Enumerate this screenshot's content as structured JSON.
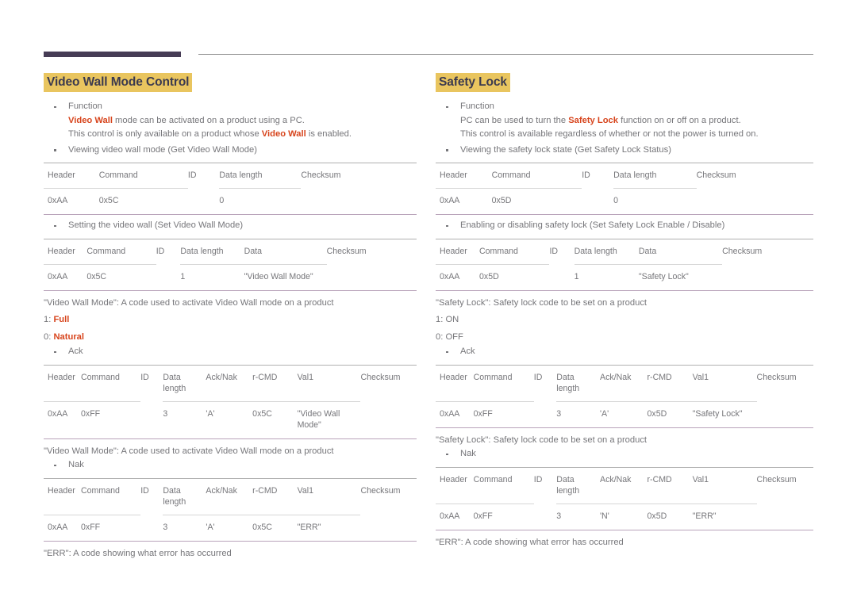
{
  "header": {
    "rule_accent_color": "#463c55",
    "rule_line_color": "#8c8c8c"
  },
  "theme": {
    "heading_highlight": "#e9c55f",
    "heading_text": "#3b3a4f",
    "emphasis": "#d7441c",
    "body_text": "#76767a",
    "table_rule": "#b0b0b0",
    "table_bottom_rule": "#b9a3ba"
  },
  "left": {
    "heading": "Video Wall Mode Control",
    "function_bullet": {
      "label": "Function",
      "line1_pre": "",
      "line1_emph": "Video Wall",
      "line1_post": " mode can be activated on a product using a PC.",
      "line2_pre": "This control is only available on a product whose ",
      "line2_emph": "Video Wall",
      "line2_post": " is enabled."
    },
    "get_bullet": "Viewing video wall mode (Get Video Wall Mode)",
    "get_table": {
      "headers": [
        "Header",
        "Command",
        "ID",
        "Data length",
        "Checksum"
      ],
      "row": [
        "0xAA",
        "0x5C",
        "",
        "0",
        ""
      ]
    },
    "set_bullet": "Setting the video wall (Set Video Wall Mode)",
    "set_table": {
      "headers": [
        "Header",
        "Command",
        "ID",
        "Data length",
        "Data",
        "Checksum"
      ],
      "row": [
        "0xAA",
        "0x5C",
        "",
        "1",
        "\"Video Wall Mode\"",
        ""
      ]
    },
    "note_after_set": "\"Video Wall Mode\": A code used to activate Video Wall mode on a product",
    "values": [
      {
        "key": "1: ",
        "val": "Full"
      },
      {
        "key": "0: ",
        "val": "Natural"
      }
    ],
    "ack_bullet": "Ack",
    "ack_table": {
      "headers": [
        "Header",
        "Command",
        "ID",
        "Data length",
        "Ack/Nak",
        "r-CMD",
        "Val1",
        "Checksum"
      ],
      "row": [
        "0xAA",
        "0xFF",
        "",
        "3",
        "'A'",
        "0x5C",
        "\"Video Wall Mode\"",
        ""
      ]
    },
    "note_after_ack": "\"Video Wall Mode\": A code used to activate Video Wall mode on a product",
    "nak_bullet": "Nak",
    "nak_table": {
      "headers": [
        "Header",
        "Command",
        "ID",
        "Data length",
        "Ack/Nak",
        "r-CMD",
        "Val1",
        "Checksum"
      ],
      "row": [
        "0xAA",
        "0xFF",
        "",
        "3",
        "'A'",
        "0x5C",
        "\"ERR\"",
        ""
      ]
    },
    "note_after_nak": "\"ERR\": A code showing what error has occurred"
  },
  "right": {
    "heading": "Safety Lock",
    "function_bullet": {
      "label": "Function",
      "line1_pre": "PC can be used to turn the ",
      "line1_emph": "Safety Lock",
      "line1_post": " function on or off on a product.",
      "line2": "This control is available regardless of whether or not the power is turned on."
    },
    "get_bullet": "Viewing the safety lock state (Get Safety Lock Status)",
    "get_table": {
      "headers": [
        "Header",
        "Command",
        "ID",
        "Data length",
        "Checksum"
      ],
      "row": [
        "0xAA",
        "0x5D",
        "",
        "0",
        ""
      ]
    },
    "set_bullet": "Enabling or disabling safety lock (Set Safety Lock Enable / Disable)",
    "set_table": {
      "headers": [
        "Header",
        "Command",
        "ID",
        "Data length",
        "Data",
        "Checksum"
      ],
      "row": [
        "0xAA",
        "0x5D",
        "",
        "1",
        "\"Safety Lock\"",
        ""
      ]
    },
    "note_after_set": "\"Safety Lock\": Safety lock code to be set on a product",
    "values": [
      {
        "key": "1: ",
        "val": "ON"
      },
      {
        "key": "0: ",
        "val": "OFF"
      }
    ],
    "ack_bullet": "Ack",
    "ack_table": {
      "headers": [
        "Header",
        "Command",
        "ID",
        "Data length",
        "Ack/Nak",
        "r-CMD",
        "Val1",
        "Checksum"
      ],
      "row": [
        "0xAA",
        "0xFF",
        "",
        "3",
        "'A'",
        "0x5D",
        "\"Safety Lock\"",
        ""
      ]
    },
    "note_after_ack": "\"Safety Lock\": Safety lock code to be set on a product",
    "nak_bullet": "Nak",
    "nak_table": {
      "headers": [
        "Header",
        "Command",
        "ID",
        "Data length",
        "Ack/Nak",
        "r-CMD",
        "Val1",
        "Checksum"
      ],
      "row": [
        "0xAA",
        "0xFF",
        "",
        "3",
        "'N'",
        "0x5D",
        "\"ERR\"",
        ""
      ]
    },
    "note_after_nak": "\"ERR\": A code showing what error has occurred"
  }
}
